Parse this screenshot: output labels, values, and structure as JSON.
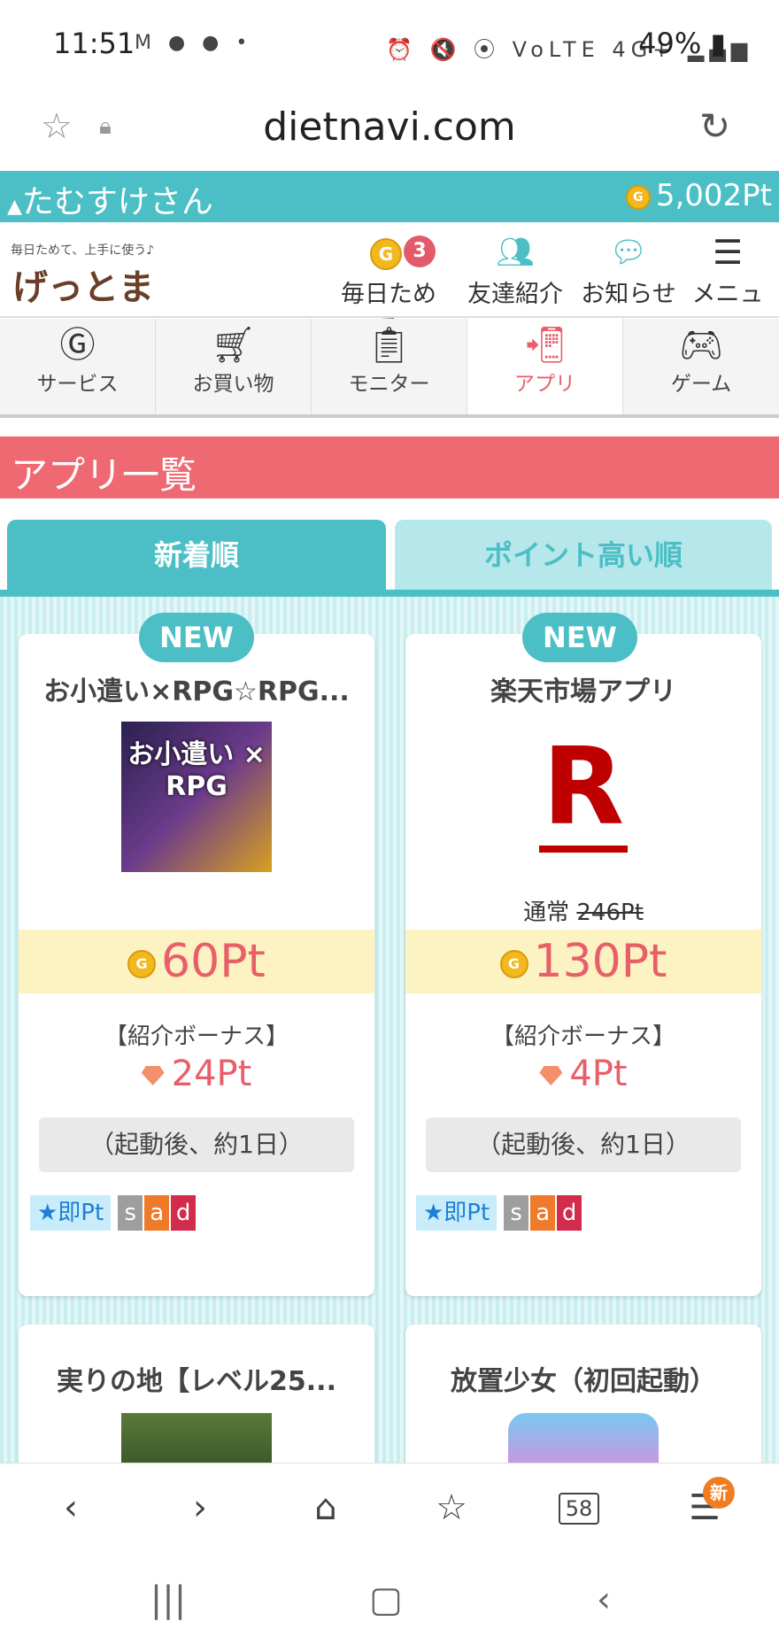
{
  "status": {
    "time": "11:51",
    "left_icons": "M ● ● •",
    "right_icons": "⏰ 🔇 ⦿ VoLTE 4G+ ▂▄▆",
    "battery": "49%"
  },
  "browser": {
    "url": "dietnavi.com",
    "tab_count": "58",
    "menu_badge": "新"
  },
  "user": {
    "name": "たむすけさん",
    "points": "5,002Pt"
  },
  "header": {
    "logo_tagline": "毎日ためて、上手に使う♪",
    "logo": "げっとま",
    "items": [
      {
        "label": "毎日ためる",
        "badge": "3"
      },
      {
        "label": "友達紹介"
      },
      {
        "label": "お知らせ"
      },
      {
        "label": "メニュ"
      }
    ]
  },
  "categories": [
    {
      "label": "サービス",
      "icon": "g-circle-icon"
    },
    {
      "label": "お買い物",
      "icon": "cart-icon"
    },
    {
      "label": "モニター",
      "icon": "monitor-icon"
    },
    {
      "label": "アプリ",
      "icon": "phone-download-icon",
      "active": true
    },
    {
      "label": "ゲーム",
      "icon": "gamepad-icon"
    }
  ],
  "section_title": "アプリ一覧",
  "sort_tabs": [
    "新着順",
    "ポイント高い順"
  ],
  "cards": [
    {
      "badge": "NEW",
      "title": "お小遣い×RPG☆RPG...",
      "img_text": "お小遣い × RPG",
      "points": "60Pt",
      "bonus_label": "【紹介ボーナス】",
      "bonus": "24Pt",
      "condition": "（起動後、約1日）",
      "tags": [
        "★即Pt",
        "s",
        "a",
        "d"
      ]
    },
    {
      "badge": "NEW",
      "title": "楽天市場アプリ",
      "logo_letter": "R",
      "usual_label": "通常",
      "usual_points": "246Pt",
      "points": "130Pt",
      "bonus_label": "【紹介ボーナス】",
      "bonus": "4Pt",
      "condition": "（起動後、約1日）",
      "tags": [
        "★即Pt",
        "s",
        "a",
        "d"
      ]
    },
    {
      "title": "実りの地【レベル25..."
    },
    {
      "title": "放置少女（初回起動）"
    }
  ],
  "colors": {
    "teal": "#4bbfc5",
    "pink": "#ef6972",
    "points_red": "#e85f6a",
    "band_yellow": "#fdf3c2"
  }
}
